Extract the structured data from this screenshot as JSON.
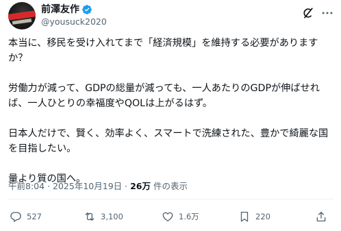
{
  "author": {
    "display_name": "前澤友作",
    "handle": "@yousuck2020",
    "verified": true
  },
  "tweet": {
    "text": "本当に、移民を受け入れてまで「経済規模」を維持する必要がありますか？\n\n労働力が減って、GDPの総量が減っても、一人あたりのGDPが伸ばせれば、一人ひとりの幸福度やQOLは上がるはず。\n\n日本人だけで、賢く、効率よく、スマートで洗練された、豊かで綺麗な国を目指したい。\n\n量より質の国へ。"
  },
  "meta": {
    "time": "午前8:04",
    "separator": "·",
    "date": "2025年10月19日",
    "views_count": "26万",
    "views_label": "件の表示"
  },
  "actions": {
    "reply_count": "527",
    "retweet_count": "3,100",
    "like_count": "1.6万",
    "bookmark_count": "220"
  },
  "icons": {
    "verified": "verified-badge-icon",
    "grok": "grok-icon",
    "more": "more-options-icon",
    "reply": "reply-icon",
    "retweet": "retweet-icon",
    "like": "heart-icon",
    "bookmark": "bookmark-icon",
    "share": "share-icon"
  },
  "colors": {
    "text_primary": "#0f1419",
    "text_secondary": "#536471",
    "verified_blue": "#1d9bf0",
    "divider": "#eff3f4"
  }
}
